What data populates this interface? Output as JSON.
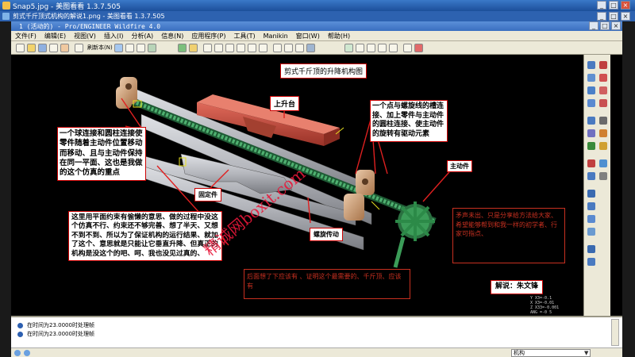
{
  "viewer": {
    "title": "Snap5.jpg - 美图看看 1.3.7.505",
    "inner_title": "剪式千斤顶式机构的解说1.png - 美图看看 1.3.7.505"
  },
  "proe": {
    "title": "1 (活动的) - Pro/ENGINEER Wildfire 4.0",
    "menu": [
      "文件(F)",
      "编辑(E)",
      "视图(V)",
      "插入(I)",
      "分析(A)",
      "信息(N)",
      "应用程序(P)",
      "工具(T)",
      "Manikin",
      "窗口(W)",
      "帮助(H)"
    ],
    "toolbar_label": "刷新本(N)",
    "messages": [
      "在时间为23.0000时处理帧",
      "在时间为23.0000时处理帧"
    ],
    "filter_value": "机构"
  },
  "annotations": {
    "diagram_title": "剪式千斤顶的升降机构图",
    "lift_platform": "上升台",
    "fixed_part": "固定件",
    "screw_drive": "螺旋传动",
    "active_part": "主动件",
    "ball_joint_note": "一个球连接和圆柱连接使零件随着主动件位置移动而移动、且与主动件保持在同一平面、这也是我做的这个仿真的重点",
    "point_line_note": "一个点与螺旋线的槽连接、加上零件与主动件的圆柱连接、使主动件的旋转有驱动元素",
    "plane_constraint_note": "这里用平面约束有偷懒的意思、做的过程中没这个仿真不行、约束还不够完善、想了半天、又想不到不到、所以为了保证机构的运行结果、就加了这个、意思就是只能让它垂直升降、但真正的机构是没这个的吧、呵、我也没见过真的、",
    "after_note": "后面想了下应该有 、证明这个最需要的、千斤顶、应该有",
    "share_note": "矛声未出、只是分享给方法给大家、希望能够帮到和我一样的初学者、行家可指点、",
    "narrator": "解说：朱文锋",
    "watermark": "精诚网boxit.com"
  },
  "colors": {
    "frame": "#ece9d8",
    "viewport_bg": "#000000",
    "rail": "#b4b6bc",
    "screw": "#2e7d4a",
    "lift_platform": "#c0463a",
    "annotation_red": "#c83020",
    "watermark": "#e8183a"
  }
}
